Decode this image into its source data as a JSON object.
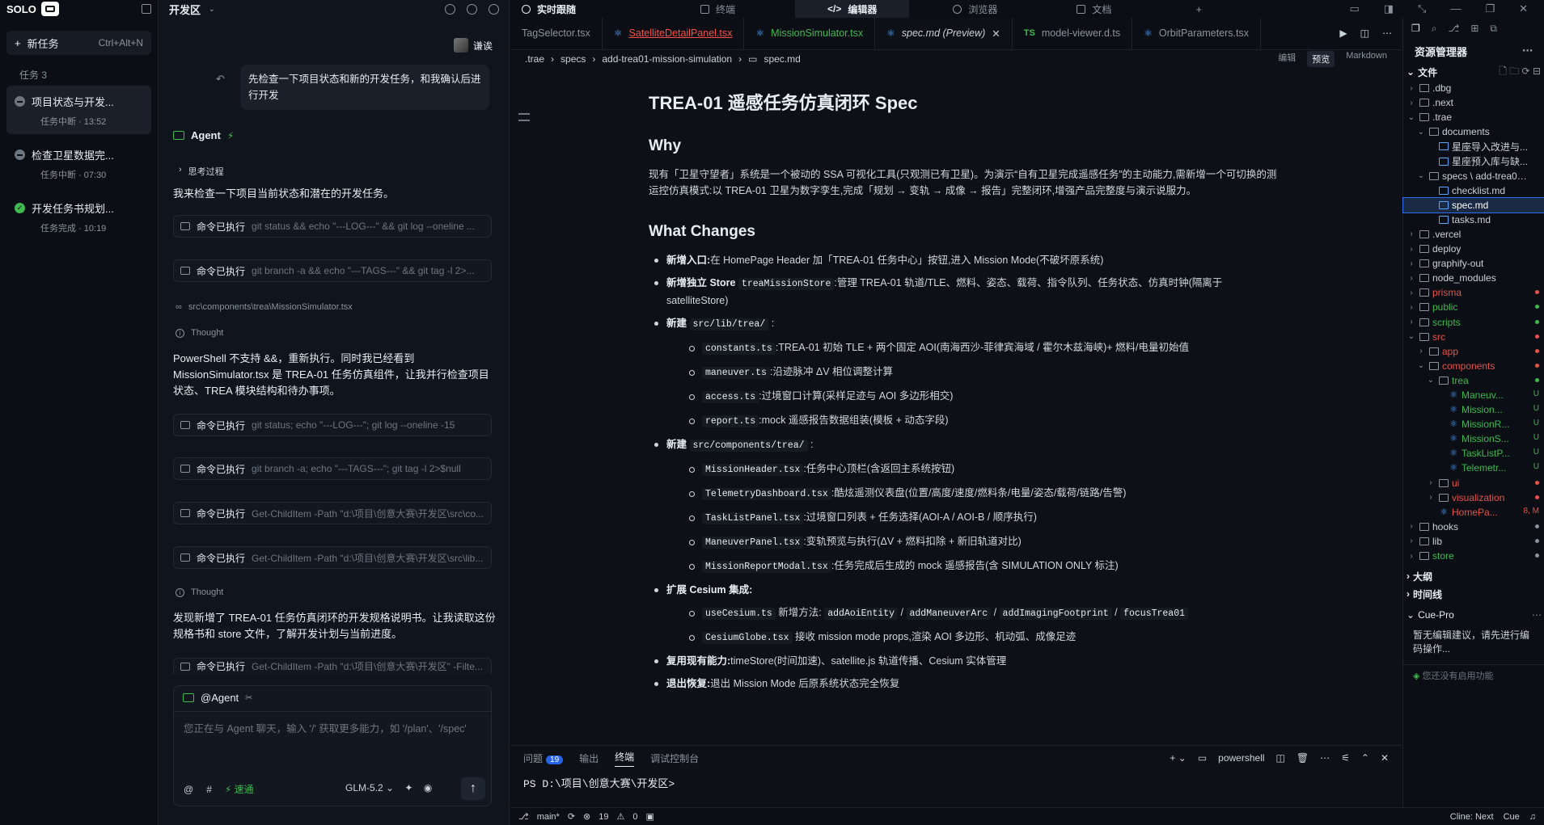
{
  "app": {
    "brand": "SOLO"
  },
  "rail": {
    "new_task": "新任务",
    "new_task_kbd": "Ctrl+Alt+N",
    "count_label": "任务  3",
    "tasks": [
      {
        "title": "项目状态与开发...",
        "meta": "任务中断 · 13:52",
        "status": "paused"
      },
      {
        "title": "检查卫星数据完...",
        "meta": "任务中断 · 07:30",
        "status": "paused"
      },
      {
        "title": "开发任务书规划...",
        "meta": "任务完成 · 10:19",
        "status": "done"
      }
    ]
  },
  "chat": {
    "workspace": "开发区",
    "user_name": "谦诶",
    "user_message": "先检查一下项目状态和新的开发任务，和我确认后进行开发",
    "agent_label": "Agent",
    "thinking_label": "思考过程",
    "p1": "我来检查一下项目当前状态和潜在的开发任务。",
    "cmd_label": "命令已执行",
    "cmds": [
      "git status && echo \"---LOG---\" && git log --oneline ...",
      "git branch -a && echo \"---TAGS---\" && git tag -l 2>...",
      "git status; echo \"---LOG---\"; git log --oneline -15",
      "git branch -a; echo \"---TAGS---\"; git tag -l 2>$null",
      "Get-ChildItem -Path \"d:\\项目\\创意大赛\\开发区\\src\\co...",
      "Get-ChildItem -Path \"d:\\项目\\创意大赛\\开发区\\src\\lib...",
      "Get-ChildItem -Path \"d:\\项目\\创意大赛\\开发区\" -Filte..."
    ],
    "file_ref": "src\\components\\trea\\MissionSimulator.tsx",
    "thought": "Thought",
    "p2": "PowerShell 不支持 &&，重新执行。同时我已经看到 MissionSimulator.tsx 是 TREA-01 任务仿真组件，让我并行检查项目状态、TREA 模块结构和待办事项。",
    "p3": "发现新增了 TREA-01 任务仿真闭环的开发规格说明书。让我读取这份规格书和 store 文件，了解开发计划与当前进度。",
    "input_chip": "@Agent",
    "placeholder": "您正在与 Agent 聊天，输入 '/' 获取更多能力，如 '/plan'、'/spec'",
    "speed": "速通",
    "model": "GLM-5.2"
  },
  "topbar": {
    "tabs": [
      "实时跟随",
      "终端",
      "编辑器",
      "浏览器",
      "文档"
    ],
    "active": "编辑器"
  },
  "editor": {
    "tabs": [
      {
        "name": "TagSelector.tsx",
        "kind": "react",
        "style": ""
      },
      {
        "name": "SatelliteDetailPanel.tsx",
        "kind": "react",
        "style": "red"
      },
      {
        "name": "MissionSimulator.tsx",
        "kind": "react",
        "style": "green"
      },
      {
        "name": "spec.md (Preview)",
        "kind": "md",
        "style": "on"
      },
      {
        "name": "model-viewer.d.ts",
        "kind": "ts",
        "style": ""
      },
      {
        "name": "OrbitParameters.tsx",
        "kind": "react",
        "style": ""
      }
    ],
    "breadcrumb": [
      ".trae",
      "specs",
      "add-trea01-mission-simulation",
      "spec.md"
    ],
    "modes": {
      "edit": "编辑",
      "preview": "预览",
      "md": "Markdown"
    }
  },
  "doc": {
    "title": "TREA-01 遥感任务仿真闭环 Spec",
    "why_h": "Why",
    "why_p": "现有「卫星守望者」系统是一个被动的 SSA 可视化工具(只观测已有卫星)。为演示“自有卫星完成遥感任务”的主动能力,需新增一个可切换的测运控仿真模式:以 TREA-01 卫星为数字孪生,完成「规划 → 变轨 → 成像 → 报告」完整闭环,增强产品完整度与演示说服力。",
    "changes_h": "What Changes",
    "c1_b": "新增入口:",
    "c1": "在 HomePage Header 加「TREA-01 任务中心」按钮,进入 Mission Mode(不破坏原系统)",
    "c2_b": "新增独立 Store",
    "c2_code": "treaMissionStore",
    "c2": ":管理 TREA-01 轨道/TLE、燃料、姿态、载荷、指令队列、任务状态、仿真时钟(隔离于 satelliteStore)",
    "c3_b": "新建",
    "c3_code": "src/lib/trea/",
    "c3_items": [
      {
        "code": "constants.ts",
        "text": ":TREA-01 初始 TLE + 两个固定 AOI(南海西沙-菲律宾海域 / 霍尔木兹海峡)+ 燃料/电量初始值"
      },
      {
        "code": "maneuver.ts",
        "text": ":沿迹脉冲 ΔV 相位调整计算"
      },
      {
        "code": "access.ts",
        "text": ":过境窗口计算(采样足迹与 AOI 多边形相交)"
      },
      {
        "code": "report.ts",
        "text": ":mock 遥感报告数据组装(模板 + 动态字段)"
      }
    ],
    "c4_b": "新建",
    "c4_code": "src/components/trea/",
    "c4_items": [
      {
        "code": "MissionHeader.tsx",
        "text": ":任务中心顶栏(含返回主系统按钮)"
      },
      {
        "code": "TelemetryDashboard.tsx",
        "text": ":酷炫遥测仪表盘(位置/高度/速度/燃料条/电量/姿态/载荷/链路/告警)"
      },
      {
        "code": "TaskListPanel.tsx",
        "text": ":过境窗口列表 + 任务选择(AOI-A / AOI-B / 顺序执行)"
      },
      {
        "code": "ManeuverPanel.tsx",
        "text": ":变轨预览与执行(ΔV + 燃料扣除 + 新旧轨道对比)"
      },
      {
        "code": "MissionReportModal.tsx",
        "text": ":任务完成后生成的 mock 遥感报告(含 SIMULATION ONLY 标注)"
      }
    ],
    "c5_b": "扩展 Cesium 集成:",
    "c5_items": [
      {
        "code": "useCesium.ts",
        "text": " 新增方法: ",
        "codes": [
          "addAoiEntity",
          "addManeuverArc",
          "addImagingFootprint",
          "focusTrea01"
        ]
      },
      {
        "code": "CesiumGlobe.tsx",
        "text": " 接收 mission mode props,渲染 AOI 多边形、机动弧、成像足迹",
        "codes": []
      }
    ],
    "c6_b": "复用现有能力:",
    "c6": "timeStore(时间加速)、satellite.js 轨道传播、Cesium 实体管理",
    "c7_b": "退出恢复:",
    "c7": "退出 Mission Mode 后原系统状态完全恢复"
  },
  "panel": {
    "tabs": [
      "问题",
      "输出",
      "终端",
      "调试控制台"
    ],
    "problems_count": "19",
    "shell": "powershell",
    "prompt": "PS D:\\项目\\创意大赛\\开发区>"
  },
  "status": {
    "branch": "main*",
    "errors": "19",
    "warnings": "0",
    "cline": "Cline: Next",
    "cue": "Cue"
  },
  "explorer": {
    "title": "资源管理器",
    "files_section": "文件",
    "tree": [
      {
        "d": 1,
        "name": ".dbg",
        "t": "folder",
        "c": "r"
      },
      {
        "d": 1,
        "name": ".next",
        "t": "folder",
        "c": "r"
      },
      {
        "d": 1,
        "name": ".trae",
        "t": "folder",
        "c": "o"
      },
      {
        "d": 2,
        "name": "documents",
        "t": "folder",
        "c": "o"
      },
      {
        "d": 3,
        "name": "星座导入改进与...",
        "t": "md"
      },
      {
        "d": 3,
        "name": "星座预入库与缺...",
        "t": "md"
      },
      {
        "d": 2,
        "name": "specs \\ add-trea01...",
        "t": "folder",
        "c": "o"
      },
      {
        "d": 3,
        "name": "checklist.md",
        "t": "md"
      },
      {
        "d": 3,
        "name": "spec.md",
        "t": "md",
        "sel": true
      },
      {
        "d": 3,
        "name": "tasks.md",
        "t": "md"
      },
      {
        "d": 1,
        "name": ".vercel",
        "t": "folder",
        "c": "r"
      },
      {
        "d": 1,
        "name": "deploy",
        "t": "folder",
        "c": "r"
      },
      {
        "d": 1,
        "name": "graphify-out",
        "t": "folder",
        "c": "r"
      },
      {
        "d": 1,
        "name": "node_modules",
        "t": "folder",
        "c": "r"
      },
      {
        "d": 1,
        "name": "prisma",
        "t": "folder",
        "c": "r",
        "col": "#e5534b",
        "dot": "#e5534b"
      },
      {
        "d": 1,
        "name": "public",
        "t": "folder",
        "c": "r",
        "col": "#3fb950",
        "dot": "#3fb950"
      },
      {
        "d": 1,
        "name": "scripts",
        "t": "folder",
        "c": "r",
        "col": "#3fb950",
        "dot": "#3fb950"
      },
      {
        "d": 1,
        "name": "src",
        "t": "folder",
        "c": "o",
        "col": "#e5534b",
        "dot": "#e5534b"
      },
      {
        "d": 2,
        "name": "app",
        "t": "folder",
        "c": "r",
        "col": "#e5534b",
        "dot": "#e5534b"
      },
      {
        "d": 2,
        "name": "components",
        "t": "folder",
        "c": "o",
        "col": "#e5534b",
        "dot": "#e5534b"
      },
      {
        "d": 3,
        "name": "trea",
        "t": "folder",
        "c": "o",
        "col": "#3fb950",
        "dot": "#3fb950"
      },
      {
        "d": 4,
        "name": "Maneuv...",
        "t": "react",
        "col": "#3fb950",
        "flag": "U"
      },
      {
        "d": 4,
        "name": "Mission...",
        "t": "react",
        "col": "#3fb950",
        "flag": "U"
      },
      {
        "d": 4,
        "name": "MissionR...",
        "t": "react",
        "col": "#3fb950",
        "flag": "U"
      },
      {
        "d": 4,
        "name": "MissionS...",
        "t": "react",
        "col": "#3fb950",
        "flag": "U"
      },
      {
        "d": 4,
        "name": "TaskListP...",
        "t": "react",
        "col": "#3fb950",
        "flag": "U"
      },
      {
        "d": 4,
        "name": "Telemetr...",
        "t": "react",
        "col": "#3fb950",
        "flag": "U"
      },
      {
        "d": 3,
        "name": "ui",
        "t": "folder",
        "c": "r",
        "col": "#e5534b",
        "dot": "#e5534b"
      },
      {
        "d": 3,
        "name": "visualization",
        "t": "folder",
        "c": "r",
        "col": "#e5534b",
        "dot": "#e5534b"
      },
      {
        "d": 3,
        "name": "HomePa...",
        "t": "react",
        "col": "#e5534b",
        "flag": "8, M"
      },
      {
        "d": 1,
        "name": "hooks",
        "t": "folder",
        "c": "r",
        "dot": "#8b949e"
      },
      {
        "d": 1,
        "name": "lib",
        "t": "folder",
        "c": "r",
        "dot": "#8b949e"
      },
      {
        "d": 1,
        "name": "store",
        "t": "folder",
        "c": "r",
        "col": "#3fb950",
        "dot": "#8b949e"
      }
    ],
    "outline": "大纲",
    "timeline": "时间线",
    "cue_title": "Cue-Pro",
    "cue_msg": "暂无编辑建议，请先进行编码操作...",
    "cue_link": "您还没有启用功能"
  },
  "colors": {
    "accent": "#3fb950",
    "danger": "#f85149",
    "link": "#58a6ff"
  }
}
